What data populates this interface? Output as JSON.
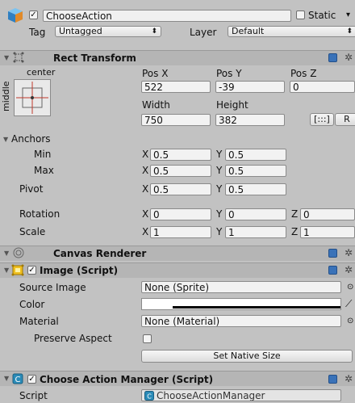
{
  "header": {
    "object_name": "ChooseAction",
    "static_label": "Static",
    "static_arrow": "▾",
    "tag_label": "Tag",
    "tag_value": "Untagged",
    "layer_label": "Layer",
    "layer_value": "Default",
    "dropdown_arrow": "⬍"
  },
  "rect_transform": {
    "title": "Rect Transform",
    "anchor_h": "center",
    "anchor_v": "middle",
    "pos_x_label": "Pos X",
    "pos_y_label": "Pos Y",
    "pos_z_label": "Pos Z",
    "pos_x": "522",
    "pos_y": "-39",
    "pos_z": "0",
    "width_label": "Width",
    "height_label": "Height",
    "width": "750",
    "height": "382",
    "blueprint_btn": "[:::]",
    "raw_btn": "R",
    "anchors_label": "Anchors",
    "min_label": "Min",
    "max_label": "Max",
    "pivot_label": "Pivot",
    "x": "X",
    "y": "Y",
    "z": "Z",
    "min_x": "0.5",
    "min_y": "0.5",
    "max_x": "0.5",
    "max_y": "0.5",
    "pivot_x": "0.5",
    "pivot_y": "0.5",
    "rotation_label": "Rotation",
    "rot_x": "0",
    "rot_y": "0",
    "rot_z": "0",
    "scale_label": "Scale",
    "scale_x": "1",
    "scale_y": "1",
    "scale_z": "1"
  },
  "canvas_renderer": {
    "title": "Canvas Renderer"
  },
  "image_script": {
    "title": "Image (Script)",
    "source_image_label": "Source Image",
    "source_image_value": "None (Sprite)",
    "color_label": "Color",
    "material_label": "Material",
    "material_value": "None (Material)",
    "preserve_aspect_label": "Preserve Aspect",
    "set_native_size": "Set Native Size",
    "color_value": "#ffffff"
  },
  "choose_action_manager": {
    "title": "Choose Action Manager (Script)",
    "script_label": "Script",
    "script_value": "ChooseActionManager"
  },
  "icons": {
    "fold": "▼",
    "gear": "✲",
    "check": "✓",
    "circle_target": "⊙",
    "eyedropper": "⟋"
  }
}
